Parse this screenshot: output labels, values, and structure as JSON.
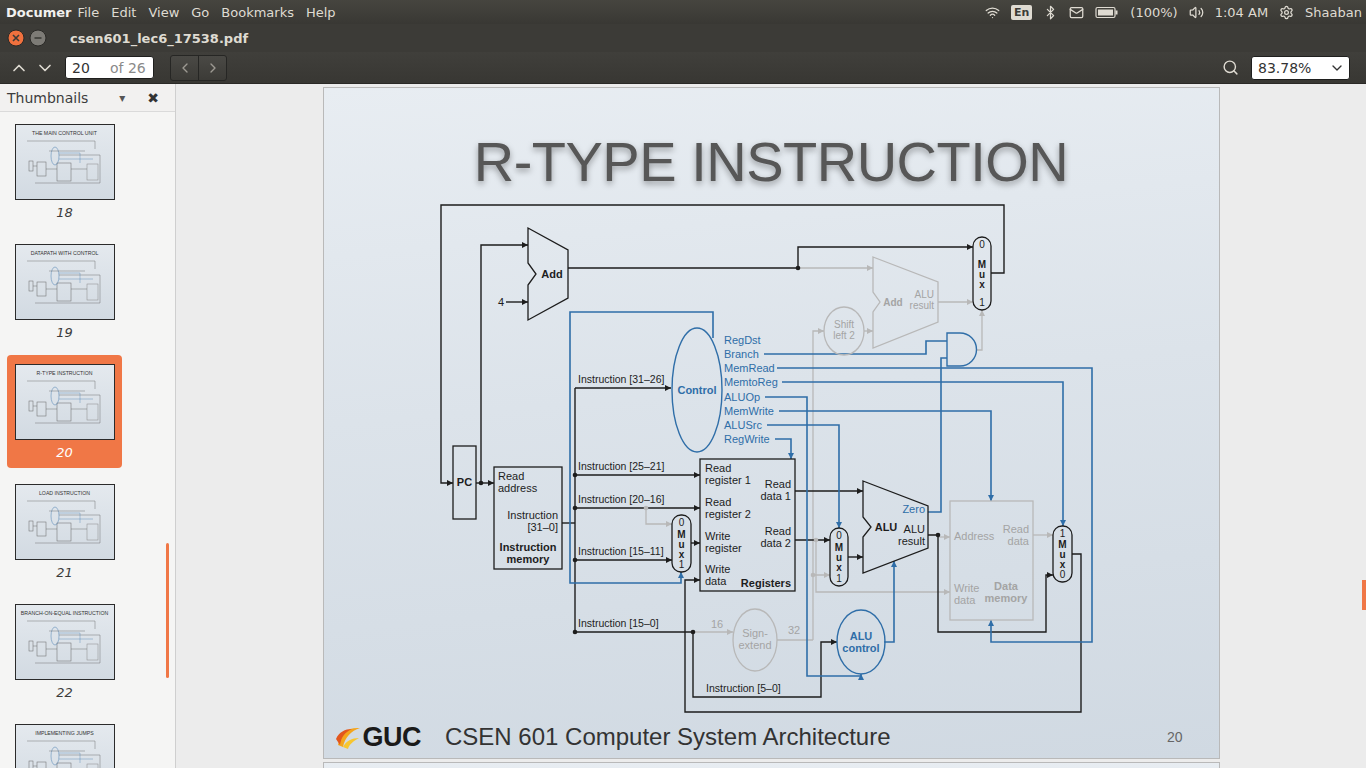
{
  "top_panel": {
    "app": "Documer",
    "menus": [
      "File",
      "Edit",
      "View",
      "Go",
      "Bookmarks",
      "Help"
    ],
    "keyboard": "En",
    "battery": {
      "reading": "(100%)",
      "level": 1
    },
    "clock": "1:04 AM",
    "user": "Shaaban"
  },
  "window": {
    "title": "csen601_lec6_17538.pdf"
  },
  "toolbar": {
    "page": "20",
    "page_count": "of 26",
    "zoom": "83.78%"
  },
  "sidebar": {
    "title": "Thumbnails",
    "menu_glyph": "▾",
    "close_glyph": "✖",
    "items": [
      {
        "page": "18",
        "slide_title": "THE MAIN CONTROL UNIT",
        "selected": false
      },
      {
        "page": "19",
        "slide_title": "DATAPATH WITH CONTROL",
        "selected": false
      },
      {
        "page": "20",
        "slide_title": "R-TYPE INSTRUCTION",
        "selected": true
      },
      {
        "page": "21",
        "slide_title": "LOAD INSTRUCTION",
        "selected": false
      },
      {
        "page": "22",
        "slide_title": "BRANCH-ON-EQUAL INSTRUCTION",
        "selected": false
      },
      {
        "slide_title": "IMPLEMENTING JUMPS",
        "selected": false
      }
    ]
  },
  "slide": {
    "title": "R-TYPE INSTRUCTION",
    "footer": {
      "logo": "GUC",
      "course": "CSEN 601 Computer System Architecture",
      "page": "20"
    },
    "diagram": {
      "pc": "PC",
      "pc_adder": {
        "label": "Add",
        "constant": "4"
      },
      "branch_adder": {
        "label": "Add",
        "result": [
          "ALU",
          "result"
        ],
        "active": false
      },
      "shift": {
        "label": [
          "Shift",
          "left 2"
        ],
        "active": false
      },
      "control": {
        "label": "Control",
        "signals": [
          "RegDst",
          "Branch",
          "MemRead",
          "MemtoReg",
          "ALUOp",
          "MemWrite",
          "ALUSrc",
          "RegWrite"
        ]
      },
      "instruction_memory": {
        "address": [
          "Read",
          "address"
        ],
        "output": [
          "Instruction",
          "[31–0]"
        ],
        "name": [
          "Instruction",
          "memory"
        ]
      },
      "fields": [
        "Instruction [31–26]",
        "Instruction [25–21]",
        "Instruction [20–16]",
        "Instruction [15–11]",
        "Instruction [15–0]",
        "Instruction [5–0]"
      ],
      "registers": {
        "inputs": [
          [
            "Read",
            "register 1"
          ],
          [
            "Read",
            "register 2"
          ],
          [
            "Write",
            "register"
          ],
          [
            "Write",
            "data"
          ]
        ],
        "outputs": [
          [
            "Read",
            "data 1"
          ],
          [
            "Read",
            "data 2"
          ]
        ],
        "name": "Registers"
      },
      "alu": {
        "label": "ALU",
        "zero": "Zero",
        "result": [
          "ALU",
          "result"
        ]
      },
      "alu_control": {
        "label": [
          "ALU",
          "control"
        ]
      },
      "sign_extend": {
        "label": [
          "Sign-",
          "extend"
        ],
        "in_bits": "16",
        "out_bits": "32",
        "active": false
      },
      "data_memory": {
        "address": "Address",
        "read": [
          "Read",
          "data"
        ],
        "write": [
          "Write",
          "data"
        ],
        "name": [
          "Data",
          "memory"
        ],
        "active": false
      },
      "muxes": [
        {
          "top": "0",
          "label": "Mux",
          "bottom": "1"
        },
        {
          "top": "0",
          "label": "Mux",
          "bottom": "1"
        },
        {
          "top": "0",
          "label": "Mux",
          "bottom": "1"
        },
        {
          "top": "1",
          "label": "Mux",
          "bottom": "0"
        }
      ]
    }
  }
}
